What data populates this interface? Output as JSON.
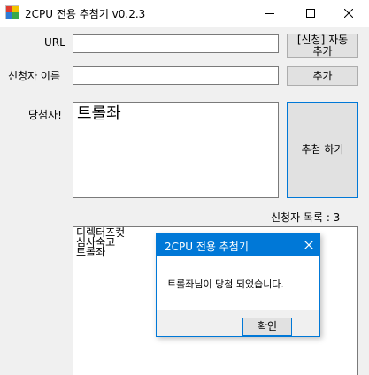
{
  "window": {
    "title": "2CPU 전용 추첨기 v0.2.3",
    "minimize_glyph": "—",
    "maximize_glyph": "☐",
    "close_glyph": "✕"
  },
  "url": {
    "label": "URL",
    "value": "",
    "auto_add_button": "[신청] 자동\n추가"
  },
  "applicant": {
    "label": "신청자 이름",
    "value": "",
    "add_button": "추가"
  },
  "winner": {
    "label": "당첨자!",
    "value": "트롤좌",
    "draw_button": "추첨 하기"
  },
  "applicant_list": {
    "count_label": "신청자 목록 : 3",
    "items": [
      "디렉터즈컷",
      "심사숙고",
      "트롤좌"
    ]
  },
  "dialog": {
    "title": "2CPU 전용 추첨기",
    "message": "트롤좌님이 당첨 되었습니다.",
    "ok_button": "확인",
    "close_glyph": "✕"
  },
  "colors": {
    "accent": "#0078d7",
    "window_bg": "#f0f0f0",
    "button_bg": "#e1e1e1"
  }
}
